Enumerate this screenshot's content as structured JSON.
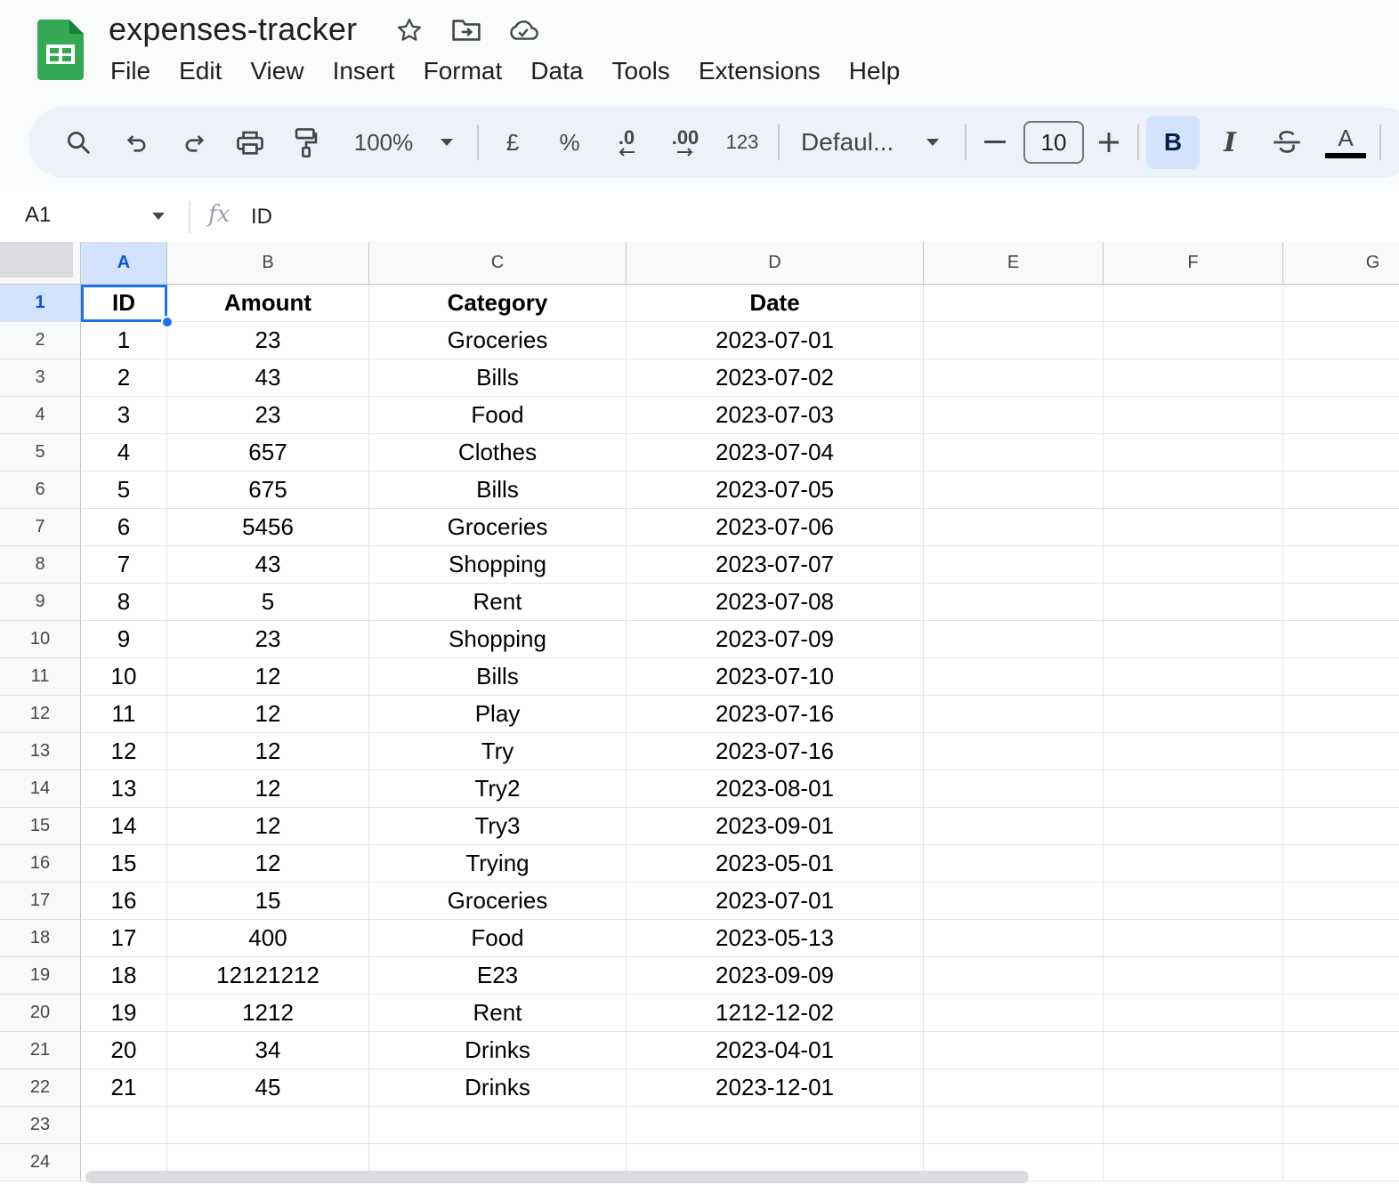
{
  "app": {
    "doc_title": "expenses-tracker",
    "menu": [
      "File",
      "Edit",
      "View",
      "Insert",
      "Format",
      "Data",
      "Tools",
      "Extensions",
      "Help"
    ]
  },
  "toolbar": {
    "zoom": "100%",
    "currency": "£",
    "percent": "%",
    "decrease_decimal": ".0",
    "increase_decimal": ".00",
    "number_format": "123",
    "font": "Defaul...",
    "font_size": "10",
    "bold": "B",
    "italic": "I",
    "text_color": "A",
    "accent_color": "#0b57d0"
  },
  "formula_bar": {
    "cell_ref": "A1",
    "fx": "fx",
    "value": "ID"
  },
  "sheet": {
    "columns": [
      "A",
      "B",
      "C",
      "D",
      "E",
      "F",
      "G"
    ],
    "row_numbers": [
      "1",
      "2",
      "3",
      "4",
      "5",
      "6",
      "7",
      "8",
      "9",
      "10",
      "11",
      "12",
      "13",
      "14",
      "15",
      "16",
      "17",
      "18",
      "19",
      "20",
      "21",
      "22",
      "23",
      "24"
    ],
    "selected_cell": "A1",
    "rows": [
      [
        "ID",
        "Amount",
        "Category",
        "Date"
      ],
      [
        "1",
        "23",
        "Groceries",
        "2023-07-01"
      ],
      [
        "2",
        "43",
        "Bills",
        "2023-07-02"
      ],
      [
        "3",
        "23",
        "Food",
        "2023-07-03"
      ],
      [
        "4",
        "657",
        "Clothes",
        "2023-07-04"
      ],
      [
        "5",
        "675",
        "Bills",
        "2023-07-05"
      ],
      [
        "6",
        "5456",
        "Groceries",
        "2023-07-06"
      ],
      [
        "7",
        "43",
        "Shopping",
        "2023-07-07"
      ],
      [
        "8",
        "5",
        "Rent",
        "2023-07-08"
      ],
      [
        "9",
        "23",
        "Shopping",
        "2023-07-09"
      ],
      [
        "10",
        "12",
        "Bills",
        "2023-07-10"
      ],
      [
        "11",
        "12",
        "Play",
        "2023-07-16"
      ],
      [
        "12",
        "12",
        "Try",
        "2023-07-16"
      ],
      [
        "13",
        "12",
        "Try2",
        "2023-08-01"
      ],
      [
        "14",
        "12",
        "Try3",
        "2023-09-01"
      ],
      [
        "15",
        "12",
        "Trying",
        "2023-05-01"
      ],
      [
        "16",
        "15",
        "Groceries",
        "2023-07-01"
      ],
      [
        "17",
        "400",
        "Food",
        "2023-05-13"
      ],
      [
        "18",
        "12121212",
        "E23",
        "2023-09-09"
      ],
      [
        "19",
        "1212",
        "Rent",
        "1212-12-02"
      ],
      [
        "20",
        "34",
        "Drinks",
        "2023-04-01"
      ],
      [
        "21",
        "45",
        "Drinks",
        "2023-12-01"
      ],
      [
        "",
        "",
        "",
        ""
      ],
      [
        "",
        "",
        "",
        ""
      ]
    ]
  }
}
